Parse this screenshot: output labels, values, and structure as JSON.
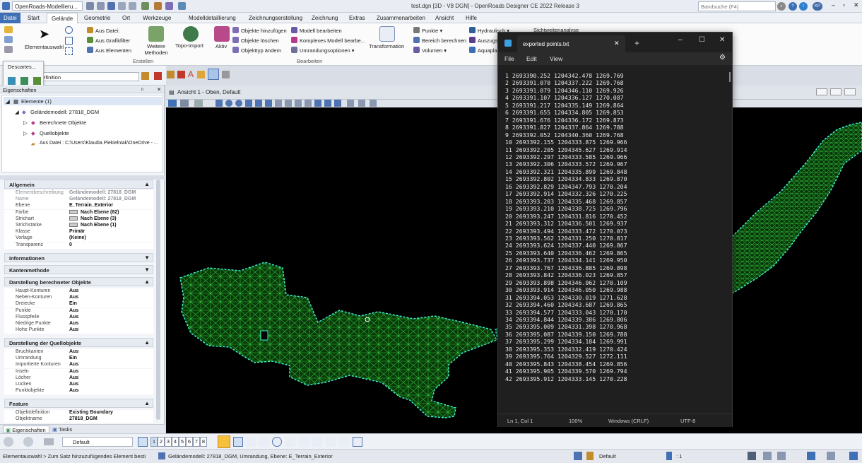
{
  "titlebar": {
    "workspace": "OpenRoads-Modellieru...",
    "title": "test.dgn [3D - V8 DGN] - OpenRoads Designer CE 2022 Release 3",
    "search_placeholder": "Bandsuche (F4)",
    "user_initials": "KP"
  },
  "menu": {
    "tabs": [
      "Datei",
      "Start",
      "Gelände",
      "Geometrie",
      "Ort",
      "Werkzeuge",
      "Modelldetaillierung",
      "Zeichnungserstellung",
      "Zeichnung",
      "Extras",
      "Zusammenarbeiten",
      "Ansicht",
      "Hilfe"
    ],
    "active": "Gelände"
  },
  "ribbon": {
    "elementauswahl": "Elementauswahl",
    "erstellen": [
      "Aus Datei:",
      "Aus Grafikfilter",
      "Aus Elementen"
    ],
    "weitere_methoden": "Weitere Methoden",
    "topo_import": "Topo-Import",
    "aktiv": "Aktiv",
    "objekte": [
      "Objekte hinzufügen",
      "Objekte löschen",
      "Objekttyp ändern"
    ],
    "modell": [
      "Modell bearbeiten",
      "Komplexes Modell bearbe...",
      "Umrandungsoptionen"
    ],
    "transformation": "Transformation",
    "punkte": [
      "Punkte",
      "Bereich berechnen",
      "Volumen"
    ],
    "hydraulisch": [
      "Hydraulisch",
      "Auszugs...",
      "Aquapla..."
    ],
    "sichtweite": "Sichtweitenanalyse",
    "group_erstellen": "Erstellen",
    "group_bearbeiten": "Bearbeiten",
    "descartes": "Descartes...",
    "definition": "definition"
  },
  "props": {
    "panel_title": "Eigenschaften",
    "tree": {
      "root": "Elemente (1)",
      "model": "Geländemodell: 27818_DGM",
      "children": [
        "Berechnete Objekte",
        "Quellobjekte"
      ],
      "source": "Aus Datei : C:\\Users\\Klaudia.Piekielniak\\OneDrive - ..."
    },
    "allgemein": {
      "title": "Allgemein",
      "rows": [
        {
          "k": "Elementbeschreibung",
          "v": "Geländemodell: 27818_DGM"
        },
        {
          "k": "Name",
          "v": "Geländemodell: 27818_DGM"
        },
        {
          "k": "Ebene",
          "v": "E_Terrain_Exterior"
        },
        {
          "k": "Farbe",
          "v": "Nach Ebene (82)"
        },
        {
          "k": "Strichart",
          "v": "Nach Ebene (3)"
        },
        {
          "k": "Strichstärke",
          "v": "Nach Ebene (1)"
        },
        {
          "k": "Klasse",
          "v": "Primär"
        },
        {
          "k": "Vorlage",
          "v": "(Keine)"
        },
        {
          "k": "Transparenz",
          "v": "0"
        }
      ]
    },
    "informationen": "Informationen",
    "kantenmethode": "Kantenmethode",
    "berechnet": {
      "title": "Darstellung berechneter Objekte",
      "rows": [
        {
          "k": "Haupt-Konturen",
          "v": "Aus"
        },
        {
          "k": "Neben-Konturen",
          "v": "Aus"
        },
        {
          "k": "Dreiecke",
          "v": "Ein"
        },
        {
          "k": "Punkte",
          "v": "Aus"
        },
        {
          "k": "Flusspfeile",
          "v": "Aus"
        },
        {
          "k": "Niedrige Punkte",
          "v": "Aus"
        },
        {
          "k": "Hohe Punkte",
          "v": "Aus"
        }
      ]
    },
    "quell": {
      "title": "Darstellung der Quellobjekte",
      "rows": [
        {
          "k": "Bruchkanten",
          "v": "Aus"
        },
        {
          "k": "Umrandung",
          "v": "Ein"
        },
        {
          "k": "Importierte Konturen",
          "v": "Aus"
        },
        {
          "k": "Inseln",
          "v": "Aus"
        },
        {
          "k": "Löcher",
          "v": "Aus"
        },
        {
          "k": "Lücken",
          "v": "Aus"
        },
        {
          "k": "Punktobjekte",
          "v": "Aus"
        }
      ]
    },
    "feature": {
      "title": "Feature",
      "rows": [
        {
          "k": "Objektdefinition",
          "v": "Existing Boundary"
        },
        {
          "k": "Objektname",
          "v": "27818_DGM"
        }
      ]
    },
    "tabs": [
      "Eigenschaften",
      "Tasks"
    ]
  },
  "view": {
    "title": "Ansicht 1 - Oben, Default"
  },
  "bottom_toolbar": {
    "level": "Default",
    "views": [
      "1",
      "2",
      "3",
      "4",
      "5",
      "6",
      "7",
      "8"
    ]
  },
  "status": {
    "left": "Elementauswahl > Zum Satz hinzuzufügendes Element besti",
    "message": "Geländemodell: 27818_DGM, Umrandung, Ebene: E_Terrain_Exterior",
    "level": "Default",
    "scale": ": 1"
  },
  "notepad": {
    "tab_title": "exported points.txt",
    "menu": [
      "File",
      "Edit",
      "View"
    ],
    "lines": [
      "1 2693390.252 1204342.478 1269.769",
      "2 2693391.070 1204337.222 1269.768",
      "3 2693391.079 1204346.110 1269.926",
      "4 2693391.107 1204336.127 1270.087",
      "5 2693391.217 1204335.149 1269.864",
      "6 2693391.655 1204334.805 1269.853",
      "7 2693391.676 1204336.172 1269.873",
      "8 2693391.827 1204337.864 1269.788",
      "9 2693392.052 1204340.360 1269.768",
      "10 2693392.155 1204333.875 1269.966",
      "11 2693392.205 1204345.627 1269.914",
      "12 2693392.297 1204333.585 1269.966",
      "13 2693392.306 1204333.572 1269.967",
      "14 2693392.321 1204335.899 1269.848",
      "15 2693392.802 1204334.833 1269.870",
      "16 2693392.829 1204347.793 1270.204",
      "17 2693392.914 1204332.326 1270.225",
      "18 2693393.203 1204335.468 1269.857",
      "19 2693393.210 1204338.725 1269.796",
      "20 2693393.247 1204331.816 1270.452",
      "21 2693393.312 1204336.501 1269.937",
      "22 2693393.494 1204333.472 1270.073",
      "23 2693393.562 1204331.250 1270.817",
      "24 2693393.624 1204337.440 1269.867",
      "25 2693393.640 1204336.462 1269.865",
      "26 2693393.737 1204334.141 1269.950",
      "27 2693393.767 1204336.885 1269.898",
      "28 2693393.842 1204336.023 1269.857",
      "29 2693393.898 1204346.062 1270.109",
      "30 2693393.914 1204346.050 1269.988",
      "31 2693394.053 1204330.019 1271.628",
      "32 2693394.460 1204343.687 1269.865",
      "33 2693394.577 1204333.043 1270.170",
      "34 2693394.844 1204339.386 1269.806",
      "35 2693395.009 1204331.398 1270.968",
      "36 2693395.087 1204339.150 1269.788",
      "37 2693395.299 1204334.184 1269.991",
      "38 2693395.353 1204332.419 1270.424",
      "39 2693395.764 1204329.527 1272.111",
      "40 2693395.843 1204338.454 1269.856",
      "41 2693395.905 1204339.570 1269.794",
      "42 2693395.912 1204333.145 1270.228"
    ],
    "status": {
      "position": "Ln 1, Col 1",
      "zoom": "100%",
      "eol": "Windows (CRLF)",
      "encoding": "UTF-8"
    }
  }
}
